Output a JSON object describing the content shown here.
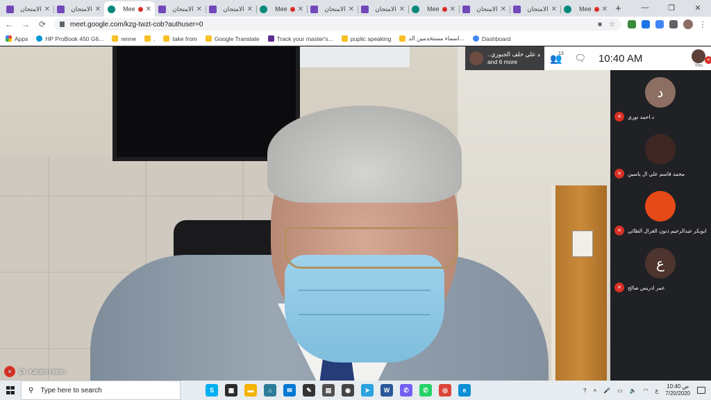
{
  "browser": {
    "tabs": [
      {
        "title": "الامتحان",
        "kind": "form",
        "active": false,
        "recording": false
      },
      {
        "title": "الامتحان",
        "kind": "form",
        "active": false,
        "recording": false
      },
      {
        "title": "Mee",
        "kind": "meet",
        "active": true,
        "recording": true
      },
      {
        "title": "الامتحان",
        "kind": "form",
        "active": false,
        "recording": false
      },
      {
        "title": "الامتحان",
        "kind": "form",
        "active": false,
        "recording": false
      },
      {
        "title": "Mee",
        "kind": "meet",
        "active": false,
        "recording": true
      },
      {
        "title": "الامتحان",
        "kind": "form",
        "active": false,
        "recording": false
      },
      {
        "title": "الامتحان",
        "kind": "form",
        "active": false,
        "recording": false
      },
      {
        "title": "Mee",
        "kind": "meet",
        "active": false,
        "recording": true
      },
      {
        "title": "الامتحان",
        "kind": "form",
        "active": false,
        "recording": false
      },
      {
        "title": "الامتحان",
        "kind": "form",
        "active": false,
        "recording": false
      },
      {
        "title": "Mee",
        "kind": "meet",
        "active": false,
        "recording": true
      }
    ],
    "url": "meet.google.com/kzg-twzt-cob?authuser=0",
    "bookmarks": [
      {
        "label": "Apps",
        "icon": "grid"
      },
      {
        "label": "HP ProBook 450 G6...",
        "icon": "hp"
      },
      {
        "label": "renne",
        "icon": "folder"
      },
      {
        "label": ".",
        "icon": "folder"
      },
      {
        "label": "take from",
        "icon": "folder"
      },
      {
        "label": "Google Translate",
        "icon": "folder"
      },
      {
        "label": "Track your master's...",
        "icon": "m"
      },
      {
        "label": "puplic speaking",
        "icon": "folder"
      },
      {
        "label": "اسماء مستخدمين الد...",
        "icon": "folder"
      },
      {
        "label": "Dashboard",
        "icon": "g"
      }
    ]
  },
  "meet": {
    "presenter": {
      "name": "..مد علي خلف الجبوري",
      "more": "and 6 more"
    },
    "participants_count": "13",
    "clock": "10:40 AM",
    "you_label": "You",
    "speaker_name": "Dr. Karam Hatim",
    "participants": [
      {
        "name": "د.احمد نوري",
        "initial": "د",
        "color": "#8d6e63"
      },
      {
        "name": "محمد قاسم علي ال ياسين",
        "initial": "",
        "color": "#3e2723"
      },
      {
        "name": "ابوبكر عبدالرحيم ذنون الغزال الطائي",
        "initial": "",
        "color": "#e64a19"
      },
      {
        "name": "عمر ادريس صالح",
        "initial": "ع",
        "color": "#4e342e"
      }
    ]
  },
  "taskbar": {
    "search_placeholder": "Type here to search",
    "apps": [
      {
        "name": "skype",
        "label": "S",
        "color": "#00aff0"
      },
      {
        "name": "store",
        "label": "▦",
        "color": "#2b2b2b"
      },
      {
        "name": "explorer",
        "label": "▬",
        "color": "#f4b400"
      },
      {
        "name": "network",
        "label": "⌂",
        "color": "#2d7d9a"
      },
      {
        "name": "mail",
        "label": "✉",
        "color": "#0078d4"
      },
      {
        "name": "notes",
        "label": "✎",
        "color": "#333333"
      },
      {
        "name": "calculator",
        "label": "▤",
        "color": "#505050"
      },
      {
        "name": "media",
        "label": "◉",
        "color": "#444444"
      },
      {
        "name": "telegram",
        "label": "➤",
        "color": "#2aa3df"
      },
      {
        "name": "word",
        "label": "W",
        "color": "#2b579a"
      },
      {
        "name": "viber",
        "label": "✆",
        "color": "#7360f2"
      },
      {
        "name": "whatsapp",
        "label": "✆",
        "color": "#25d366"
      },
      {
        "name": "chrome",
        "label": "◎",
        "color": "#db4437"
      },
      {
        "name": "edge",
        "label": "e",
        "color": "#0c8fd6"
      }
    ],
    "lang": "ع",
    "time": "10:40 ص",
    "date": "7/20/2020"
  }
}
